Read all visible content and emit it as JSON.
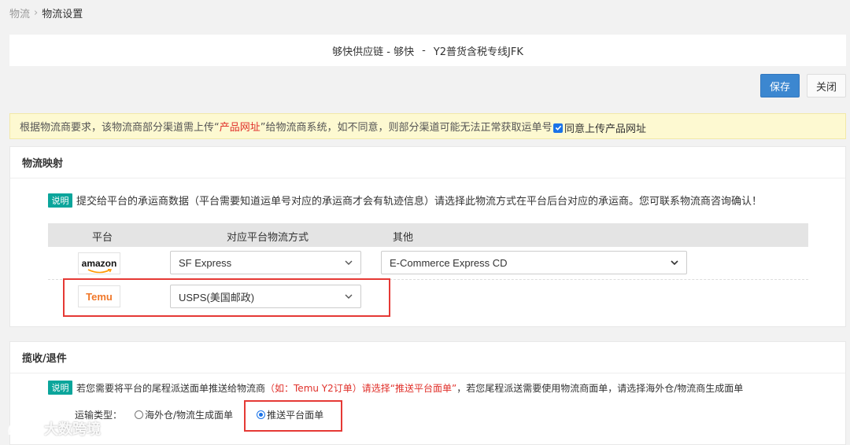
{
  "breadcrumb": {
    "parent": "物流",
    "current": "物流设置"
  },
  "title": {
    "provider": "够快供应链 - 够快",
    "separator": "-",
    "channel": "Y2普货含税专线JFK"
  },
  "toolbar": {
    "save_label": "保存",
    "close_label": "关闭"
  },
  "notice": {
    "text_before": "根据物流商要求，该物流商部分渠道需上传“",
    "highlight": "产品网址",
    "text_after": "”给物流商系统，如不同意，则部分渠道可能无法正常获取运单号",
    "agree_label": "同意上传产品网址",
    "agree_checked": true
  },
  "mapping": {
    "title": "物流映射",
    "tag": "说明",
    "description": "提交给平台的承运商数据（平台需要知道运单号对应的承运商才会有轨迹信息）请选择此物流方式在平台后台对应的承运商。您可联系物流商咨询确认！",
    "columns": [
      "平台",
      "对应平台物流方式",
      "其他"
    ],
    "rows": [
      {
        "platform": "amazon",
        "carrier": "SF Express",
        "other": "E-Commerce Express CD"
      },
      {
        "platform": "Temu",
        "carrier": "USPS(美国邮政)"
      }
    ]
  },
  "pickup": {
    "title": "揽收/退件",
    "tag": "说明",
    "desc_before": "若您需要将平台的尾程派送面单推送给物流商",
    "desc_highlight": "（如：Temu Y2订单）请选择“推送平台面单”",
    "desc_after": "，若您尾程派送需要使用物流商面单，请选择海外仓/物流商生成面单",
    "type_label": "运输类型：",
    "options": [
      "海外仓/物流生成面单",
      "推送平台面单"
    ],
    "selected": "推送平台面单"
  },
  "watermark": {
    "text": "大数跨境"
  },
  "colors": {
    "primary": "#3c87d0",
    "tag": "#0ba59b",
    "highlight": "#e0302a",
    "notice_bg": "#fdf9d1",
    "annotation": "#e53935"
  }
}
